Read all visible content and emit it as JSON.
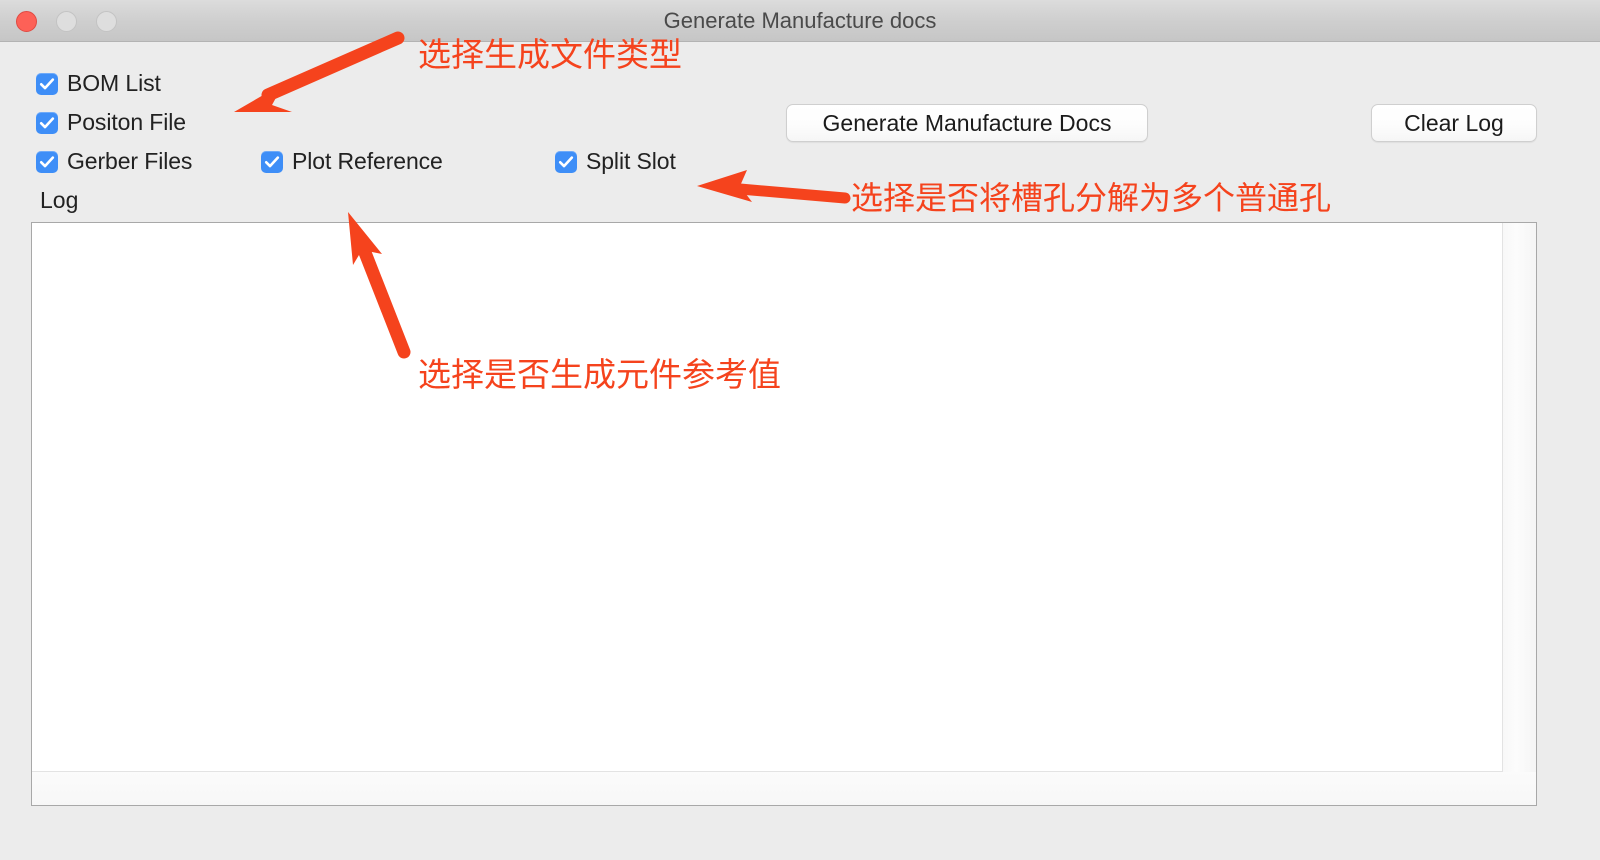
{
  "window": {
    "title": "Generate Manufacture docs",
    "traffic_lights": [
      {
        "name": "close",
        "color": "#fd6157"
      },
      {
        "name": "minimize",
        "color": "#dedede"
      },
      {
        "name": "zoom",
        "color": "#dedede"
      }
    ]
  },
  "checkboxes": [
    {
      "id": "bom",
      "label": "BOM List",
      "checked": true
    },
    {
      "id": "position",
      "label": "Positon File",
      "checked": true
    },
    {
      "id": "gerber",
      "label": "Gerber Files",
      "checked": true
    },
    {
      "id": "plotref",
      "label": "Plot Reference",
      "checked": true
    },
    {
      "id": "split",
      "label": "Split Slot",
      "checked": true
    }
  ],
  "buttons": {
    "generate": "Generate Manufacture Docs",
    "clear_log": "Clear Log"
  },
  "log": {
    "label": "Log",
    "content": ""
  },
  "annotations": [
    {
      "id": "anno-1",
      "text": "选择生成文件类型",
      "color": "#f5431d"
    },
    {
      "id": "anno-2",
      "text": "选择是否将槽孔分解为多个普通孔",
      "color": "#f5431d"
    },
    {
      "id": "anno-3",
      "text": "选择是否生成元件参考值",
      "color": "#f5431d"
    }
  ],
  "colors": {
    "checkbox_blue": "#3e8ef7",
    "annotation_red": "#f5431d",
    "window_background": "#ececec",
    "titlebar": "#cfcfcf"
  }
}
